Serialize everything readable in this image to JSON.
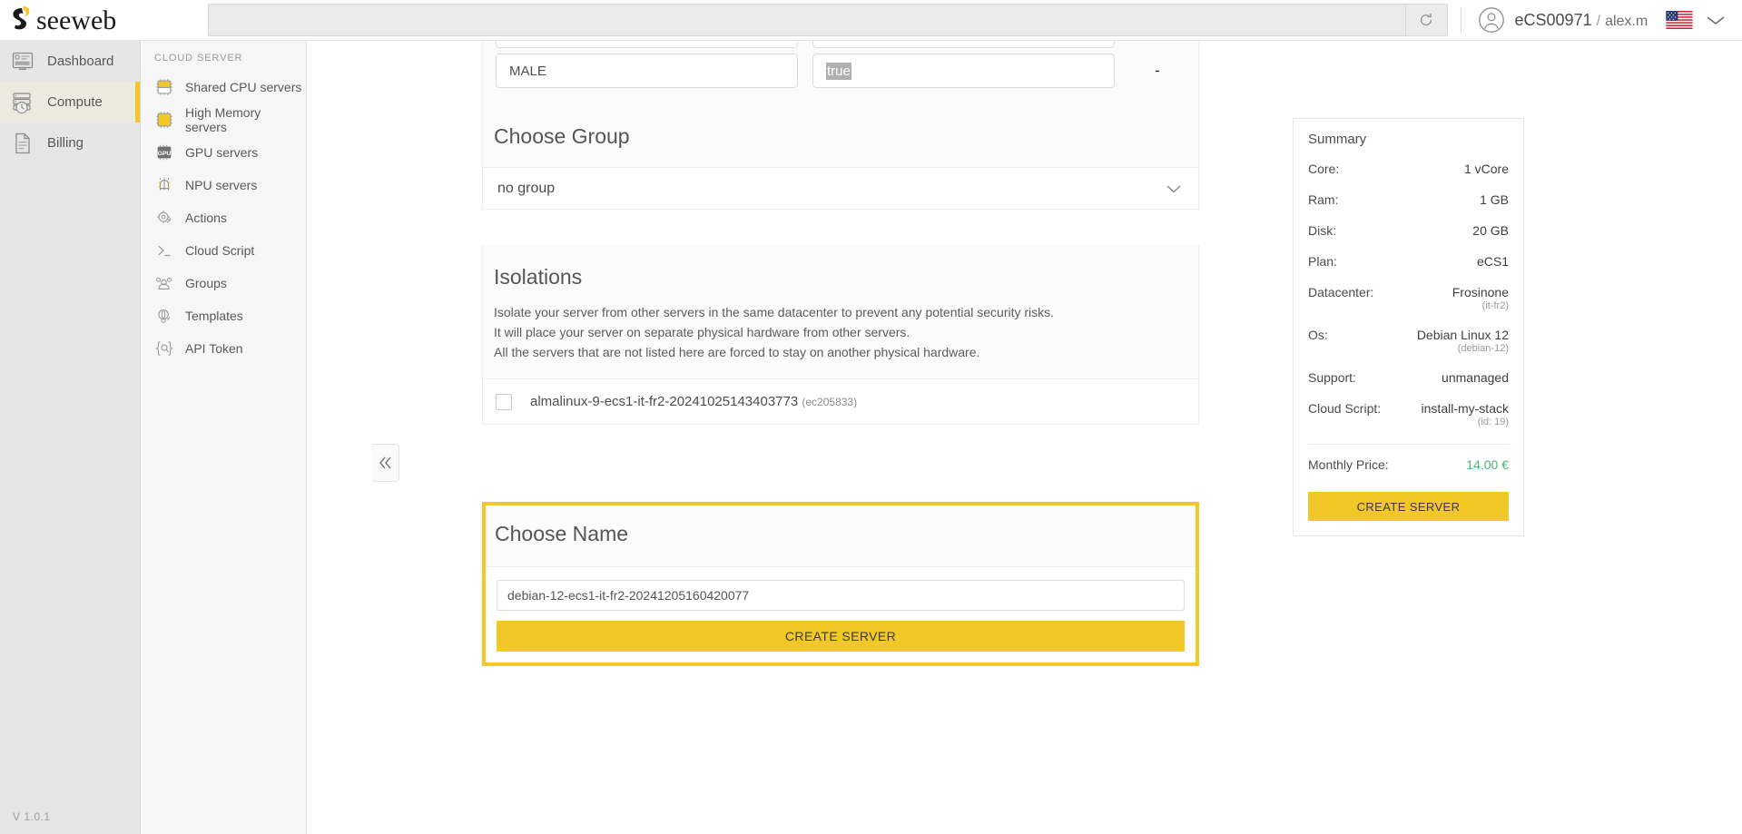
{
  "brand": {
    "name": "seeweb"
  },
  "topbar": {
    "search_placeholder": "",
    "search_value": "",
    "refresh_icon": "refresh-icon",
    "account_id": "eCS00971",
    "account_sep": "/",
    "account_user": "alex.m",
    "flag_icon": "us-flag-icon",
    "caret_icon": "chevron-down-icon"
  },
  "sidebar": {
    "version": "V 1.0.1",
    "items": [
      {
        "label": "Dashboard",
        "icon": "dashboard-icon",
        "active": false
      },
      {
        "label": "Compute",
        "icon": "server-clock-icon",
        "active": true
      },
      {
        "label": "Billing",
        "icon": "document-icon",
        "active": false
      }
    ]
  },
  "subnav": {
    "title": "CLOUD SERVER",
    "items": [
      {
        "label": "Shared CPU servers",
        "icon": "cpu-chip-icon"
      },
      {
        "label": "High Memory servers",
        "icon": "memory-chip-icon"
      },
      {
        "label": "GPU servers",
        "icon": "gpu-icon"
      },
      {
        "label": "NPU servers",
        "icon": "npu-icon"
      },
      {
        "label": "Actions",
        "icon": "actions-gear-icon"
      },
      {
        "label": "Cloud Script",
        "icon": "terminal-icon"
      },
      {
        "label": "Groups",
        "icon": "groups-icon"
      },
      {
        "label": "Templates",
        "icon": "templates-icon"
      },
      {
        "label": "API Token",
        "icon": "api-token-icon"
      }
    ]
  },
  "collapse_button": {
    "icon": "double-chevron-left-icon"
  },
  "form": {
    "field_left_value": "MALE",
    "field_right_value": "true",
    "dash_value": "-"
  },
  "group_section": {
    "heading": "Choose Group",
    "selected": "no group",
    "caret_icon": "chevron-down-icon"
  },
  "isolations": {
    "heading": "Isolations",
    "line1": "Isolate your server from other servers in the same datacenter to prevent any potential security risks.",
    "line2": "It will place your server on separate physical hardware from other servers.",
    "line3": "All the servers that are not listed here are forced to stay on another physical hardware.",
    "rows": [
      {
        "name": "almalinux-9-ecs1-it-fr2-20241025143403773",
        "id": "(ec205833)",
        "checked": false
      }
    ]
  },
  "name_section": {
    "heading": "Choose Name",
    "input_value": "debian-12-ecs1-it-fr2-20241205160420077",
    "input_placeholder": "",
    "create_button": "CREATE SERVER"
  },
  "summary": {
    "title": "Summary",
    "rows": [
      {
        "key": "Core:",
        "value": "1 vCore",
        "sub": ""
      },
      {
        "key": "Ram:",
        "value": "1 GB",
        "sub": ""
      },
      {
        "key": "Disk:",
        "value": "20 GB",
        "sub": ""
      },
      {
        "key": "Plan:",
        "value": "eCS1",
        "sub": ""
      },
      {
        "key": "Datacenter:",
        "value": "Frosinone",
        "sub": "(it-fr2)"
      },
      {
        "key": "Os:",
        "value": "Debian Linux 12",
        "sub": "(debian-12)"
      },
      {
        "key": "Support:",
        "value": "unmanaged",
        "sub": ""
      },
      {
        "key": "Cloud Script:",
        "value": "install-my-stack",
        "sub": "(id: 19)"
      }
    ],
    "price_key": "Monthly Price:",
    "price_value": "14.00 €",
    "create_button": "CREATE SERVER"
  },
  "colors": {
    "accent_yellow": "#f2c728",
    "highlight_border": "#f5c72b",
    "price_green": "#4caf77"
  }
}
